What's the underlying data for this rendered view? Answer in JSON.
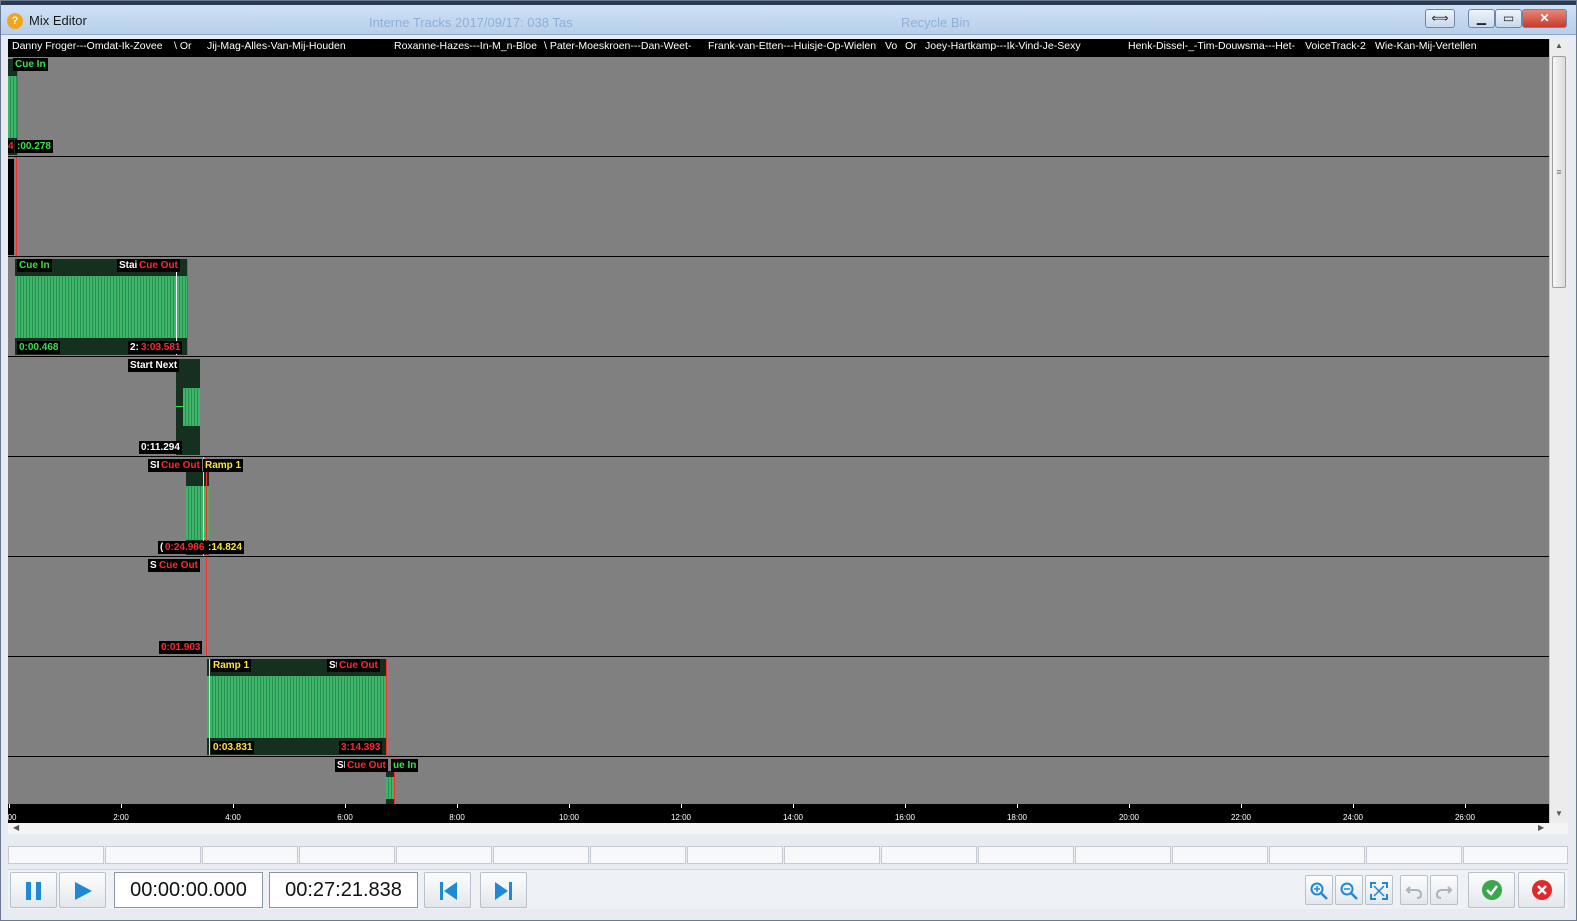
{
  "window": {
    "title": "Mix Editor",
    "ghost_left": "Interne Tracks 2017/09/17: 038 Tas",
    "ghost_right": "Recycle Bin"
  },
  "tracks": [
    {
      "name": "Danny Froger---Omdat-Ik-Zovee"
    },
    {
      "name": "\\ Or"
    },
    {
      "name": "Jij-Mag-Alles-Van-Mij-Houden"
    },
    {
      "name": "Roxanne-Hazes---In-M_n-Bloe"
    },
    {
      "name": "\\ Pater-Moeskroen---Dan-Weet-"
    },
    {
      "name": "Frank-van-Etten---Huisje-Op-Wielen"
    },
    {
      "name": "Vo"
    },
    {
      "name": "Or"
    },
    {
      "name": "Joey-Hartkamp---Ik-Vind-Je-Sexy"
    },
    {
      "name": "Henk-Dissel-_-Tim-Douwsma---Het-"
    },
    {
      "name": "VoiceTrack-2"
    },
    {
      "name": "Wie-Kan-Mij-Vertellen"
    }
  ],
  "markers": {
    "lane0": {
      "cue_in": "Cue In",
      "time": ":00.278",
      "left_digit": "4"
    },
    "lane2": {
      "cue_in": "Cue In",
      "start": "Stai",
      "cue_out": "Cue Out",
      "time_in": "0:00.468",
      "time_start": "2:",
      "time_out": "3:03.581"
    },
    "lane3": {
      "start_next": "Start Next",
      "time": "0:11.294"
    },
    "lane4": {
      "sf": "SF",
      "cue_out": "Cue Out",
      "ramp": "Ramp 1",
      "time_out": "0:24.986",
      "time_ramp": ":14.824",
      "bracket": "("
    },
    "lane5": {
      "sf": "SF",
      "cue_out": "Cue Out",
      "time": "0:01.903"
    },
    "lane6": {
      "ramp": "Ramp 1",
      "start": "St",
      "cue_out": "Cue Out",
      "time_ramp": "0:03.831",
      "time_out": "3:14.393"
    },
    "lane7": {
      "sf": "SF",
      "cue_out": "Cue Out",
      "cue_in": "ue In"
    }
  },
  "ruler": {
    "labels": [
      "00",
      "2:00",
      "4:00",
      "6:00",
      "8:00",
      "10:00",
      "12:00",
      "14:00",
      "16:00",
      "18:00",
      "20:00",
      "22:00",
      "24:00",
      "26:00"
    ]
  },
  "transport": {
    "position": "00:00:00.000",
    "duration": "00:27:21.838"
  },
  "icons": {
    "pause": "pause-icon",
    "play": "play-icon",
    "prev": "skip-back-icon",
    "next": "skip-forward-icon",
    "zoom_in": "zoom-in-icon",
    "zoom_out": "zoom-out-icon",
    "fit": "fit-icon",
    "undo": "undo-icon",
    "redo": "redo-icon",
    "ok": "check-icon",
    "cancel": "cancel-icon"
  },
  "colors": {
    "accent_blue": "#1e8ad6",
    "cue_in": "#3ae04a",
    "cue_out": "#ff2a2a",
    "ramp": "#ffe633",
    "wave": "#3fb56a",
    "lane_bg": "#808080"
  }
}
